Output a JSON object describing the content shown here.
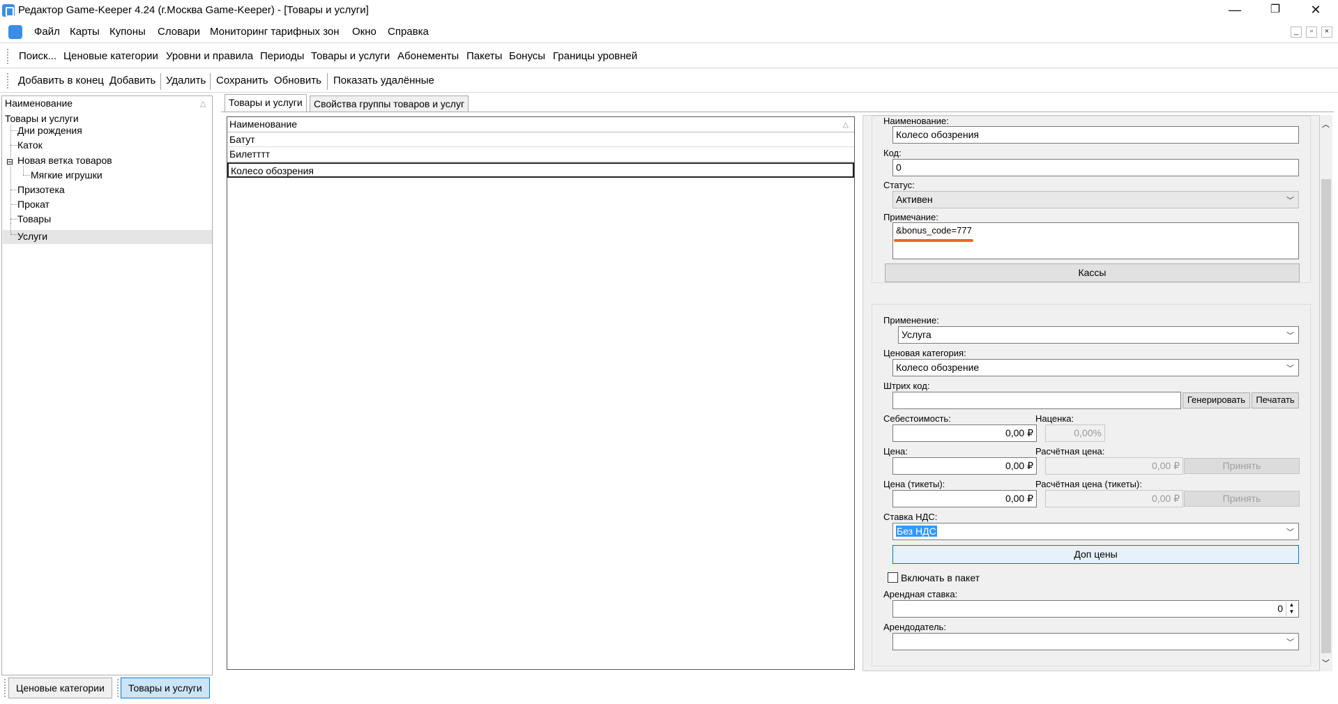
{
  "window": {
    "title": "Редактор Game-Keeper 4.24 (г.Москва Game-Keeper) - [Товары и услуги]",
    "controls": {
      "minimize": "—",
      "maximize": "❐",
      "close": "✕"
    }
  },
  "menu": [
    "Файл",
    "Карты",
    "Купоны",
    "Словари",
    "Мониторинг тарифных зон",
    "Окно",
    "Справка"
  ],
  "mdi_controls": [
    "_",
    "▫",
    "×"
  ],
  "nav_toolbar": [
    "Поиск...",
    "Ценовые категории",
    "Уровни и правила",
    "Периоды",
    "Товары и услуги",
    "Абонементы",
    "Пакеты",
    "Бонусы",
    "Границы уровней"
  ],
  "action_toolbar": [
    "Добавить в конец",
    "Добавить",
    "Удалить",
    "Сохранить",
    "Обновить",
    "Показать удалённые"
  ],
  "tree": {
    "header": "Наименование",
    "root": "Товары и услуги",
    "items": [
      "Дни рождения",
      "Каток",
      "Новая ветка товаров",
      "Мягкие игрушки",
      "Призотека",
      "Прокат",
      "Товары",
      "Услуги"
    ],
    "expander": "⊟"
  },
  "tabs": [
    "Товары и услуги",
    "Свойства группы товаров и услуг"
  ],
  "grid": {
    "header": "Наименование",
    "rows": [
      "Батут",
      "Билетттт",
      "Колесо обозрения"
    ]
  },
  "form": {
    "name_label": "Наименование:",
    "name_value": "Колесо обозрения",
    "code_label": "Код:",
    "code_value": "0",
    "status_label": "Статус:",
    "status_value": "Активен",
    "note_label": "Примечание:",
    "note_value": "&bonus_code=777",
    "kassy_button": "Кассы",
    "application_label": "Применение:",
    "application_value": "Услуга",
    "price_category_label": "Ценовая категория:",
    "price_category_value": "Колесо обозрение",
    "barcode_label": "Штрих код:",
    "barcode_value": "",
    "generate_button": "Генерировать",
    "print_button": "Печатать",
    "cost_label": "Себестоимость:",
    "cost_value": "0,00 ₽",
    "markup_label": "Наценка:",
    "markup_value": "0,00%",
    "price_label": "Цена:",
    "price_value": "0,00 ₽",
    "calc_price_label": "Расчётная цена:",
    "calc_price_value": "0,00 ₽",
    "accept_button": "Принять",
    "ticket_price_label": "Цена (тикеты):",
    "ticket_price_value": "0,00 ₽",
    "calc_ticket_price_label": "Расчётная цена (тикеты):",
    "calc_ticket_price_value": "0,00 ₽",
    "vat_label": "Ставка НДС:",
    "vat_value": "Без НДС",
    "extra_prices_button": "Доп цены",
    "include_package_label": "Включать в пакет",
    "include_package_checked": false,
    "rent_rate_label": "Арендная ставка:",
    "rent_rate_value": "0",
    "landlord_label": "Арендодатель:",
    "landlord_value": ""
  },
  "bottom_tabs": [
    "Ценовые категории",
    "Товары и услуги"
  ],
  "colors": {
    "accent": "#0078d7",
    "underline": "#f26522",
    "selection": "#3399ff"
  }
}
